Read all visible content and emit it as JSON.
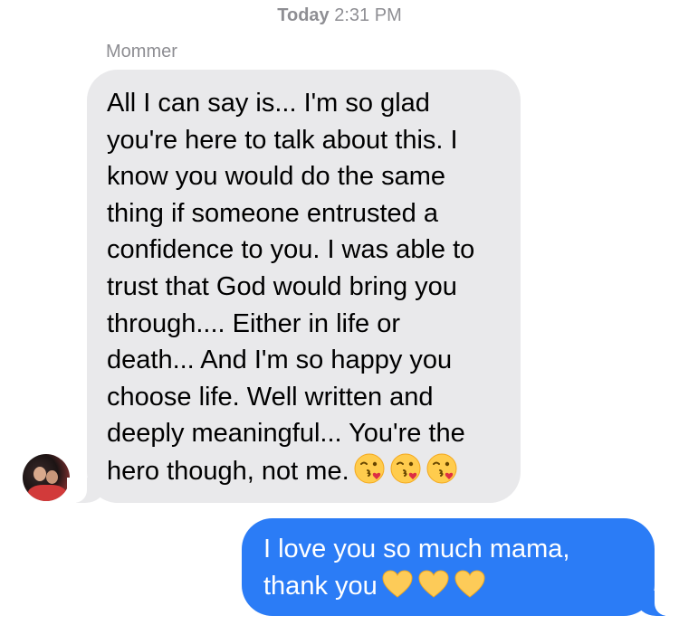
{
  "timestamp": {
    "day": "Today",
    "time": "2:31 PM"
  },
  "conversation": {
    "sender_name": "Mommer",
    "messages": [
      {
        "direction": "incoming",
        "text": "All I can say is... I'm so glad\nyou're here to talk about this. I\nknow you would do the same\nthing if someone entrusted a\nconfidence to you. I was able to\ntrust that God would bring you\nthrough.... Either in life or\ndeath... And I'm so happy you\nchoose life. Well written and\ndeeply meaningful... You're the\nhero though, not me.",
        "emoji": [
          "face-blowing-a-kiss",
          "face-blowing-a-kiss",
          "face-blowing-a-kiss"
        ]
      },
      {
        "direction": "outgoing",
        "text": "I love you so much mama,\nthank you",
        "emoji": [
          "yellow-heart",
          "yellow-heart",
          "yellow-heart"
        ]
      }
    ]
  },
  "colors": {
    "incoming_bubble": "#e9e9eb",
    "outgoing_bubble": "#2b7cf6",
    "meta_text": "#8e8e93"
  }
}
